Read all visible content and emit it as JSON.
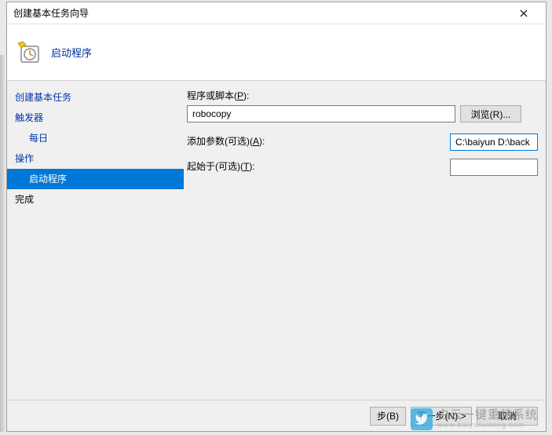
{
  "window": {
    "title": "创建基本任务向导",
    "header_text": "启动程序"
  },
  "sidebar": {
    "items": [
      {
        "label": "创建基本任务",
        "indent": false,
        "selected": false,
        "link": true
      },
      {
        "label": "触发器",
        "indent": false,
        "selected": false,
        "link": true
      },
      {
        "label": "每日",
        "indent": true,
        "selected": false,
        "link": true
      },
      {
        "label": "操作",
        "indent": false,
        "selected": false,
        "link": true
      },
      {
        "label": "启动程序",
        "indent": true,
        "selected": true,
        "link": false
      },
      {
        "label": "完成",
        "indent": false,
        "selected": false,
        "link": false
      }
    ]
  },
  "form": {
    "program_label_pre": "程序或脚本(",
    "program_label_u": "P",
    "program_label_post": "):",
    "program_value": "robocopy",
    "browse_label_pre": "浏览(",
    "browse_label_u": "R",
    "browse_label_post": ")...",
    "args_label_pre": "添加参数(可选)(",
    "args_label_u": "A",
    "args_label_post": "):",
    "args_value": "C:\\baiyun D:\\back /e",
    "startin_label_pre": "起始于(可选)(",
    "startin_label_u": "T",
    "startin_label_post": "):",
    "startin_value": ""
  },
  "footer": {
    "back_pre": "步(",
    "back_u": "B",
    "back_post": ")",
    "next_pre": "下一步(",
    "next_u": "N",
    "next_post": ") >",
    "cancel": "取消"
  },
  "watermark": {
    "big": "白云一键重装系统",
    "small": "www.baiyunxitong.com"
  }
}
